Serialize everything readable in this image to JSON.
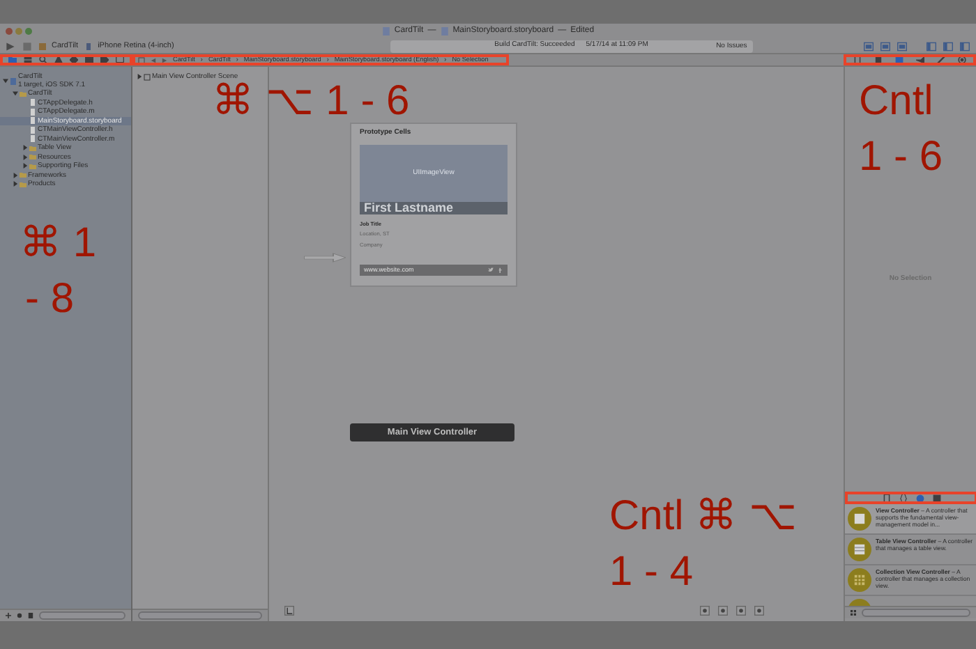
{
  "window": {
    "project": "CardTilt",
    "separator": "—",
    "document": "MainStoryboard.storyboard",
    "state": "Edited"
  },
  "toolbar": {
    "scheme": "CardTilt",
    "destination": "iPhone Retina (4-inch)",
    "activity": "Build CardTilt: Succeeded",
    "time": "5/17/14 at 11:09 PM",
    "issues": "No Issues"
  },
  "navigator_tabs": {
    "highlighted": true,
    "tabs": [
      {
        "selected": true
      },
      {
        "selected": false
      },
      {
        "selected": false
      },
      {
        "selected": false
      },
      {
        "selected": false
      },
      {
        "selected": false
      },
      {
        "selected": false
      },
      {
        "selected": false
      }
    ]
  },
  "jump_bar": {
    "highlighted": true,
    "separator": "›",
    "items": [
      "CardTilt",
      "CardTilt",
      "MainStoryboard.storyboard",
      "MainStoryboard.storyboard (English)",
      "No Selection"
    ]
  },
  "inspector_tabs": {
    "highlighted": true,
    "tabs": [
      {
        "selected": false
      },
      {
        "selected": false
      },
      {
        "selected": true
      },
      {
        "selected": false
      },
      {
        "selected": false
      },
      {
        "selected": false
      }
    ]
  },
  "file_tree": [
    {
      "kind": "project",
      "label": "CardTilt",
      "subtitle": "1 target, iOS SDK 7.1",
      "expanded": true,
      "selected": false,
      "children": [
        {
          "kind": "folder",
          "label": "CardTilt",
          "expanded": true,
          "selected": false,
          "children": [
            {
              "kind": "file",
              "label": "CTAppDelegate.h",
              "selected": false
            },
            {
              "kind": "file",
              "label": "CTAppDelegate.m",
              "selected": false
            },
            {
              "kind": "file",
              "label": "MainStoryboard.storyboard",
              "selected": true
            },
            {
              "kind": "file",
              "label": "CTMainViewController.h",
              "selected": false
            },
            {
              "kind": "file",
              "label": "CTMainViewController.m",
              "selected": false
            },
            {
              "kind": "folder",
              "label": "Table View",
              "expanded": false,
              "selected": false
            },
            {
              "kind": "folder",
              "label": "Resources",
              "expanded": false,
              "selected": false
            },
            {
              "kind": "folder",
              "label": "Supporting Files",
              "expanded": false,
              "selected": false
            }
          ]
        },
        {
          "kind": "folder",
          "label": "Frameworks",
          "expanded": false,
          "selected": false
        },
        {
          "kind": "folder",
          "label": "Products",
          "expanded": false,
          "selected": false
        }
      ]
    }
  ],
  "outline": [
    {
      "label": "Main View Controller Scene",
      "expanded": false
    }
  ],
  "canvas": {
    "section": "Prototype Cells",
    "image_label": "UIImageView",
    "name": "First Lastname",
    "details": [
      "Job Title",
      "Location, ST",
      "Company"
    ],
    "footer_link": "www.website.com",
    "scene_label": "Main View Controller"
  },
  "inspector": {
    "empty_text": "No Selection"
  },
  "library_tabs": {
    "highlighted": true,
    "tabs": [
      {
        "selected": false
      },
      {
        "selected": false
      },
      {
        "selected": true
      },
      {
        "selected": false
      }
    ]
  },
  "library": [
    {
      "title": "View Controller",
      "description": "– A controller that supports the fundamental view-management model in..."
    },
    {
      "title": "Table View Controller",
      "description": "– A controller that manages a table view."
    },
    {
      "title": "Collection View Controller",
      "description": "– A controller that manages a collection view."
    }
  ],
  "annotations": [
    "⌘ 1",
    "- 8",
    "⌘ ⌥ 1 - 6",
    "Cntl",
    "1 - 6",
    "Cntl ⌘ ⌥",
    "1 - 4"
  ]
}
